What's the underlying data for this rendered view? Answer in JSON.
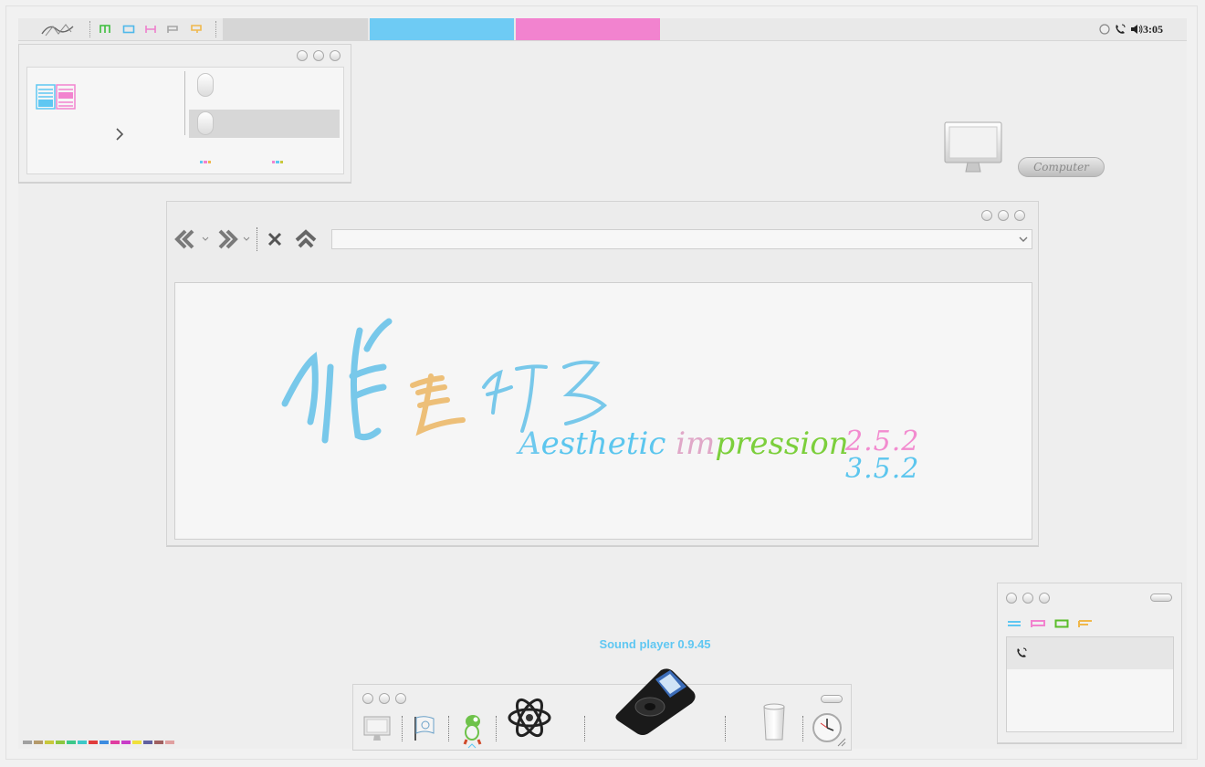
{
  "topbar": {
    "icons": [
      "logo-icon",
      "menu-green-icon",
      "window-blue-icon",
      "h-pink-icon",
      "p-grey-icon",
      "q-orange-icon"
    ],
    "tray_icons": [
      "circle-icon",
      "phone-icon",
      "volume-icon"
    ],
    "clock": "3:05",
    "segment_colors": [
      "#d6d6d6",
      "#6ecbf4",
      "#f283cf"
    ]
  },
  "desktop": {
    "computer_label": "Computer"
  },
  "browser": {
    "address_value": "",
    "banner": {
      "tagline_parts": [
        "A",
        "esthetic ",
        "im",
        "pression"
      ],
      "version_primary": "2.5.2",
      "version_secondary": "3.5.2"
    }
  },
  "dock": {
    "title": "Sound player 0.9.45",
    "items": [
      "monitor-icon",
      "flag-icon",
      "yoshi-icon",
      "atom-icon",
      "ipod-icon",
      "trash-icon",
      "clock-icon"
    ]
  },
  "palette_colors": [
    "#a0a0a0",
    "#b59a6b",
    "#c8c83c",
    "#8dc63f",
    "#3cc88a",
    "#3cc8c8",
    "#e03c3c",
    "#3c8ce0",
    "#e03ca0",
    "#c83cc8",
    "#f0e03c",
    "#6060a0",
    "#a06060",
    "#e0a0a0"
  ],
  "accent": {
    "blue": "#5fc7f2",
    "pink": "#f283cf",
    "green": "#7ccf3c",
    "orange": "#f0b84c"
  }
}
